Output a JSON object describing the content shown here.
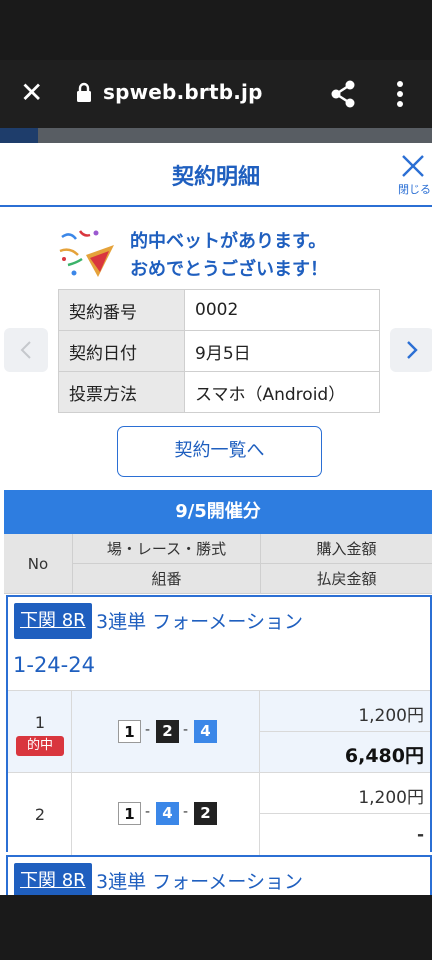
{
  "browser": {
    "url": "spweb.brtb.jp",
    "close_icon": "close-icon",
    "lock_icon": "lock-icon",
    "share_icon": "share-icon",
    "more_icon": "more-vert-icon"
  },
  "modal": {
    "title": "契約明細",
    "close_label": "閉じる"
  },
  "congrats": {
    "line1": "的中ベットがあります。",
    "line2": "おめでとうございます！"
  },
  "info": {
    "rows": [
      {
        "key": "契約番号",
        "value": "0002"
      },
      {
        "key": "契約日付",
        "value": "9月5日"
      },
      {
        "key": "投票方法",
        "value": "スマホ（Android）"
      }
    ]
  },
  "list_button": "契約一覧へ",
  "date_band": "9/5開催分",
  "bet_header": {
    "no": "No",
    "race": "場・レース・勝式",
    "combo": "組番",
    "purchase": "購入金額",
    "payout": "払戻金額"
  },
  "cards": [
    {
      "race_tag": "下関 8R",
      "race_type": "3連単 フォーメーション",
      "combo_title": "1-24-24",
      "bets": [
        {
          "no": "1",
          "hit": "的中",
          "boats": [
            "1",
            "2",
            "4"
          ],
          "purchase": "1,200円",
          "payout": "6,480円"
        },
        {
          "no": "2",
          "boats": [
            "1",
            "4",
            "2"
          ],
          "purchase": "1,200円",
          "payout": "-"
        }
      ]
    },
    {
      "race_tag": "下関 8R",
      "race_type": "3連単 フォーメーション"
    }
  ],
  "colors": {
    "accent": "#2b6fd4",
    "band": "#2e7de0",
    "hit": "#d9363e",
    "boat_2": "#222222",
    "boat_4": "#3b87e8"
  }
}
